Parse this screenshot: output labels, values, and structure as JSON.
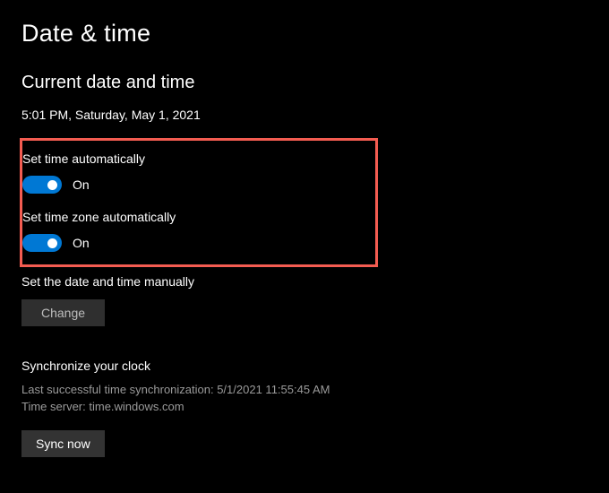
{
  "page_title": "Date & time",
  "current": {
    "heading": "Current date and time",
    "value": "5:01 PM, Saturday, May 1, 2021"
  },
  "auto_time": {
    "label": "Set time automatically",
    "state": "On"
  },
  "auto_zone": {
    "label": "Set time zone automatically",
    "state": "On"
  },
  "manual": {
    "label": "Set the date and time manually",
    "button": "Change"
  },
  "sync": {
    "heading": "Synchronize your clock",
    "last": "Last successful time synchronization: 5/1/2021 11:55:45 AM",
    "server": "Time server: time.windows.com",
    "button": "Sync now"
  }
}
